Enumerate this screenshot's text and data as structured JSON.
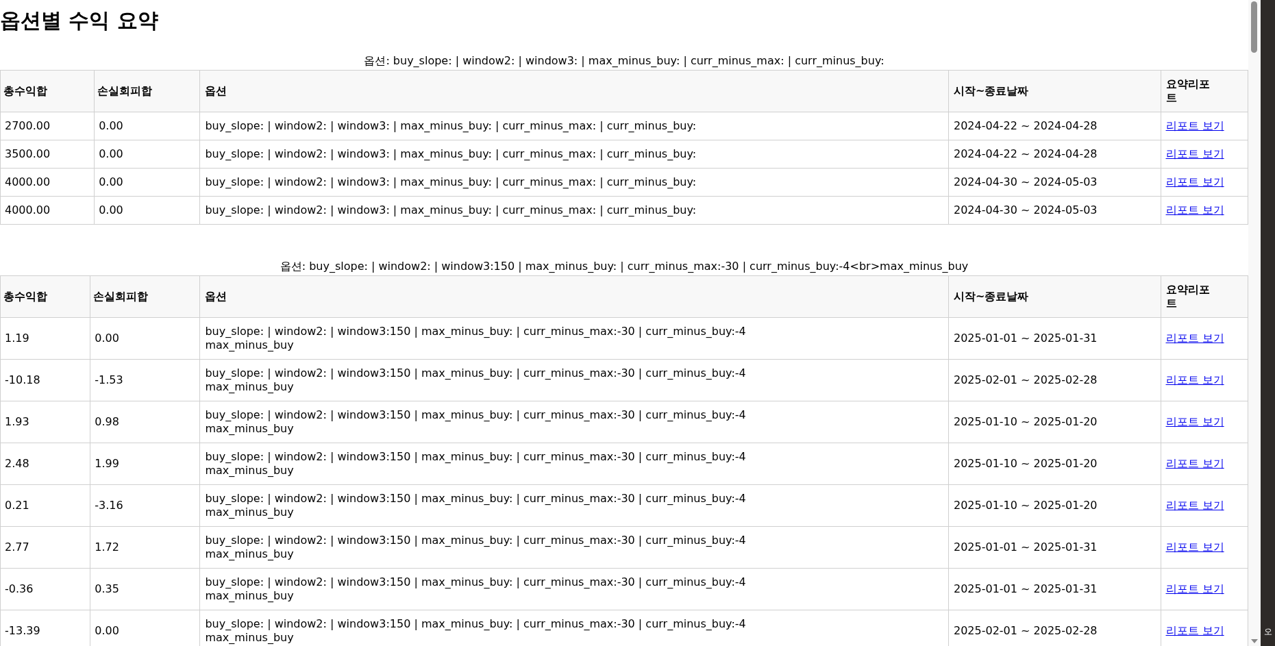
{
  "title": "옵션별 수익 요약",
  "tables": [
    {
      "caption": "옵션: buy_slope: | window2: | window3: | max_minus_buy: | curr_minus_max: | curr_minus_buy:",
      "columns": [
        "총수익합",
        "손실회피합",
        "옵션",
        "시작~종료날짜",
        "요약리포트"
      ],
      "rows": [
        {
          "total": "2700.00",
          "loss": "0.00",
          "options": "buy_slope: | window2: | window3: | max_minus_buy: | curr_minus_max: | curr_minus_buy:",
          "period": "2024-04-22 ~ 2024-04-28",
          "link": "리포트 보기"
        },
        {
          "total": "3500.00",
          "loss": "0.00",
          "options": "buy_slope: | window2: | window3: | max_minus_buy: | curr_minus_max: | curr_minus_buy:",
          "period": "2024-04-22 ~ 2024-04-28",
          "link": "리포트 보기"
        },
        {
          "total": "4000.00",
          "loss": "0.00",
          "options": "buy_slope: | window2: | window3: | max_minus_buy: | curr_minus_max: | curr_minus_buy:",
          "period": "2024-04-30 ~ 2024-05-03",
          "link": "리포트 보기"
        },
        {
          "total": "4000.00",
          "loss": "0.00",
          "options": "buy_slope: | window2: | window3: | max_minus_buy: | curr_minus_max: | curr_minus_buy:",
          "period": "2024-04-30 ~ 2024-05-03",
          "link": "리포트 보기"
        }
      ]
    },
    {
      "caption": "옵션: buy_slope: | window2: | window3:150 | max_minus_buy: | curr_minus_max:-30 | curr_minus_buy:-4<br>max_minus_buy",
      "columns": [
        "총수익합",
        "손실회피합",
        "옵션",
        "시작~종료날짜",
        "요약리포트"
      ],
      "rows": [
        {
          "total": "1.19",
          "loss": "0.00",
          "options": "buy_slope: | window2: | window3:150 | max_minus_buy: | curr_minus_max:-30 | curr_minus_buy:-4\nmax_minus_buy",
          "period": "2025-01-01 ~ 2025-01-31",
          "link": "리포트 보기"
        },
        {
          "total": "-10.18",
          "loss": "-1.53",
          "options": "buy_slope: | window2: | window3:150 | max_minus_buy: | curr_minus_max:-30 | curr_minus_buy:-4\nmax_minus_buy",
          "period": "2025-02-01 ~ 2025-02-28",
          "link": "리포트 보기"
        },
        {
          "total": "1.93",
          "loss": "0.98",
          "options": "buy_slope: | window2: | window3:150 | max_minus_buy: | curr_minus_max:-30 | curr_minus_buy:-4\nmax_minus_buy",
          "period": "2025-01-10 ~ 2025-01-20",
          "link": "리포트 보기"
        },
        {
          "total": "2.48",
          "loss": "1.99",
          "options": "buy_slope: | window2: | window3:150 | max_minus_buy: | curr_minus_max:-30 | curr_minus_buy:-4\nmax_minus_buy",
          "period": "2025-01-10 ~ 2025-01-20",
          "link": "리포트 보기"
        },
        {
          "total": "0.21",
          "loss": "-3.16",
          "options": "buy_slope: | window2: | window3:150 | max_minus_buy: | curr_minus_max:-30 | curr_minus_buy:-4\nmax_minus_buy",
          "period": "2025-01-10 ~ 2025-01-20",
          "link": "리포트 보기"
        },
        {
          "total": "2.77",
          "loss": "1.72",
          "options": "buy_slope: | window2: | window3:150 | max_minus_buy: | curr_minus_max:-30 | curr_minus_buy:-4\nmax_minus_buy",
          "period": "2025-01-01 ~ 2025-01-31",
          "link": "리포트 보기"
        },
        {
          "total": "-0.36",
          "loss": "0.35",
          "options": "buy_slope: | window2: | window3:150 | max_minus_buy: | curr_minus_max:-30 | curr_minus_buy:-4\nmax_minus_buy",
          "period": "2025-01-01 ~ 2025-01-31",
          "link": "리포트 보기"
        },
        {
          "total": "-13.39",
          "loss": "0.00",
          "options": "buy_slope: | window2: | window3:150 | max_minus_buy: | curr_minus_max:-30 | curr_minus_buy:-4\nmax_minus_buy",
          "period": "2025-02-01 ~ 2025-02-28",
          "link": "리포트 보기"
        }
      ]
    }
  ],
  "side_panel": {
    "text": "오"
  }
}
